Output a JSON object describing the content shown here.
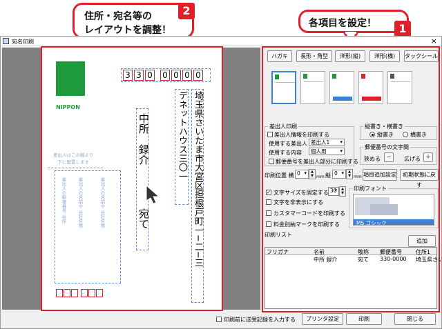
{
  "callouts": {
    "left": {
      "line1": "住所・宛名等の",
      "line2": "レイアウトを調整！",
      "badge": "2"
    },
    "right": {
      "text": "各項目を設定！",
      "badge": "1"
    }
  },
  "window": {
    "title": "宛名印刷",
    "close": "×"
  },
  "postcard": {
    "zip_boxes": [
      "3",
      "3",
      "0",
      "0",
      "0",
      "0",
      "0"
    ],
    "brand": "NIPPON",
    "address_line1": "埼玉県さいたま市大宮区担根戸町一−二−三",
    "address_line2": "デネットハウス三〇一",
    "recipient_name": "中所　録介",
    "recipient_honorific": "宛て",
    "sender_note": "差出人はこの線より\n下に配置します",
    "sender_placeholders": [
      "差出人の郵便番号\n住所",
      "差出人の名前や\n会社名等",
      "差出人の名前や\n会社名等"
    ]
  },
  "toolbar": {
    "buttons": [
      "ハガキ",
      "長形・角型",
      "洋形(縦)",
      "洋形(横)",
      "タックシール"
    ]
  },
  "sender_group": {
    "title": "差出人印刷",
    "print_sender_info": "差出人情報を印刷する",
    "sender_label": "使用する差出人",
    "sender_value": "差出人1",
    "content_label": "使用する内容",
    "content_value": "個人用",
    "zip_in_sender": "郵便番号を差出人部分に印刷する"
  },
  "writing_group": {
    "title": "縦書き・横書き",
    "vertical": "縦書き",
    "horizontal": "横書き"
  },
  "zip_spacing_group": {
    "title": "郵便番号の文字間",
    "narrow": "狭める",
    "minus": "−",
    "widen": "広げる",
    "plus": "＋"
  },
  "print_position": {
    "label": "印刷位置 横",
    "x_value": "0",
    "x_unit": "mm",
    "y_label": "縦",
    "y_value": "0",
    "y_unit": "mm",
    "add_item": "項目追加設定",
    "reset": "初期状態に戻す"
  },
  "options": {
    "fix_font_size": "文字サイズを固定する",
    "font_size": "30",
    "hide_text": "文字を非表示にする",
    "customer_barcode": "カスタマーコードを印刷する",
    "postage_mark": "料金別納マークを印刷する"
  },
  "font_group": {
    "title": "印刷フォント",
    "selected_font": "MS ゴシック"
  },
  "print_list": {
    "title": "印刷リスト",
    "add_button": "追加",
    "columns": [
      "フリガナ",
      "名前",
      "敬称",
      "郵便番号",
      "住所1"
    ],
    "rows": [
      [
        "",
        "中所 録介",
        "宛て",
        "330-0000",
        "埼玉県さい"
      ]
    ]
  },
  "footer": {
    "record_history": "印刷前に送受記録を入力する",
    "printer_settings": "プリンタ設定",
    "print": "印刷",
    "close": "閉じる"
  },
  "colors": {
    "accent": "#e01f2b",
    "brand_green": "#1f9a3a",
    "guide_blue": "#5f8fd0"
  }
}
